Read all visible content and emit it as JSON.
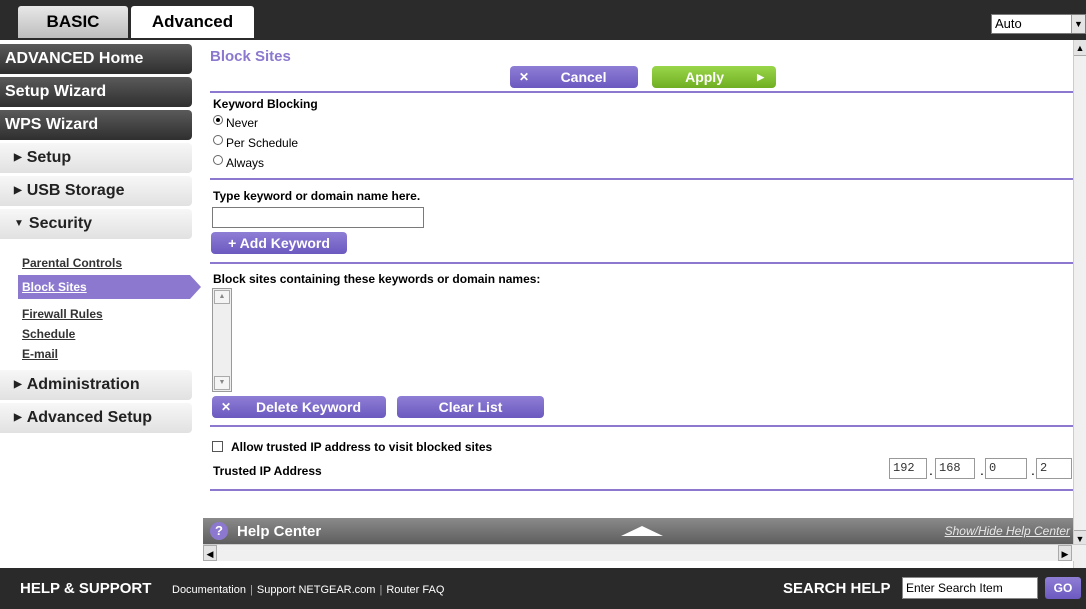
{
  "tabs": {
    "basic": "BASIC",
    "advanced": "Advanced"
  },
  "language_select": {
    "value": "Auto"
  },
  "sidebar": {
    "advanced_home": "ADVANCED Home",
    "setup_wizard": "Setup Wizard",
    "wps_wizard": "WPS Wizard",
    "setup": "Setup",
    "usb_storage": "USB Storage",
    "security": "Security",
    "security_items": [
      "Parental Controls",
      "Block Sites",
      "Firewall Rules",
      "Schedule",
      "E-mail"
    ],
    "administration": "Administration",
    "advanced_setup": "Advanced Setup"
  },
  "main": {
    "title": "Block Sites",
    "cancel_label": "Cancel",
    "apply_label": "Apply",
    "keyword_blocking_label": "Keyword Blocking",
    "radio_options": [
      "Never",
      "Per Schedule",
      "Always"
    ],
    "selected_option": "Never",
    "keyword_prompt": "Type keyword or domain name here.",
    "keyword_value": "",
    "add_keyword_label": "+ Add Keyword",
    "block_list_label": "Block sites containing these keywords or domain names:",
    "delete_keyword_label": "Delete Keyword",
    "clear_list_label": "Clear List",
    "allow_trusted_label": "Allow trusted IP address to visit blocked sites",
    "allow_trusted_checked": false,
    "trusted_ip_label": "Trusted IP Address",
    "trusted_ip": [
      "192",
      "168",
      "0",
      "2"
    ]
  },
  "help_center": {
    "title": "Help Center",
    "toggle": "Show/Hide Help Center"
  },
  "footer": {
    "title": "HELP & SUPPORT",
    "links": [
      "Documentation",
      "Support NETGEAR.com",
      "Router FAQ"
    ],
    "search_title": "SEARCH HELP",
    "search_placeholder": "Enter Search Item",
    "go_label": "GO"
  },
  "colors": {
    "accent": "#8c79cf",
    "apply": "#7fbf2e",
    "dark": "#2b2b2b"
  }
}
